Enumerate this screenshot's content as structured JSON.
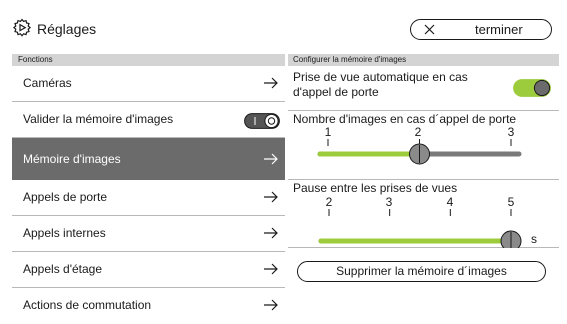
{
  "header": {
    "title": "Réglages",
    "done_label": "terminer",
    "settings_icon": "gear-icon",
    "close_icon": "close-icon"
  },
  "left": {
    "section_title": "Fonctions",
    "items": [
      {
        "label": "Caméras",
        "icon": "arrow-right-icon"
      },
      {
        "label": "Valider la mémoire d'images",
        "control": "toggle",
        "on": false
      },
      {
        "label": "Mémoire d'images",
        "icon": "arrow-right-icon",
        "selected": true
      },
      {
        "label": "Appels de porte",
        "icon": "arrow-right-icon"
      },
      {
        "label": "Appels internes",
        "icon": "arrow-right-icon"
      },
      {
        "label": "Appels d'étage",
        "icon": "arrow-right-icon"
      },
      {
        "label": "Actions de commutation",
        "icon": "arrow-right-icon"
      }
    ]
  },
  "right": {
    "section_title": "Configurer la mémoire d'images",
    "auto_capture": {
      "label": "Prise de vue automatique en cas d'appel de porte",
      "on": true
    },
    "image_count": {
      "label": "Nombre d'images en cas d´appel de porte",
      "ticks": [
        "1",
        "2",
        "3"
      ],
      "value": 2,
      "min": 1,
      "max": 3
    },
    "pause": {
      "label": "Pause entre les prises de vues",
      "ticks": [
        "2",
        "3",
        "4",
        "5"
      ],
      "value": 5,
      "min": 2,
      "max": 5,
      "unit": "s"
    },
    "delete_label": "Supprimer la mémoire d´images"
  },
  "colors": {
    "accent": "#9ccc3c",
    "selected_bg": "#6b6b6b",
    "section_bg": "#d4d4d4",
    "track_off": "#7a7a7a"
  }
}
